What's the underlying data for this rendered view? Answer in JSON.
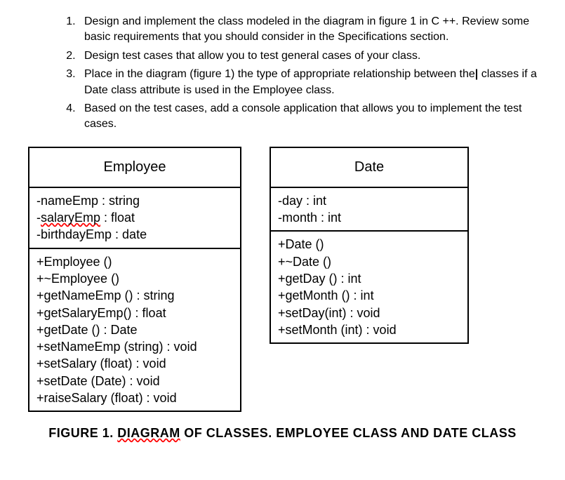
{
  "instructions": {
    "item1": "Design and implement the class modeled in the diagram in figure 1 in C ++. Review some basic requirements that you should consider in the Specifications section.",
    "item2": "Design test cases that allow you to test general cases of your class.",
    "item3_part1": "Place in the diagram (figure 1) the type of appropriate relationship between the",
    "item3_cursor": "|",
    "item3_part2": " classes if a Date class attribute is used in the Employee class.",
    "item4": "Based on the test cases, add a console application that allows you to implement the test cases."
  },
  "uml": {
    "employee": {
      "title": "Employee",
      "attr1": "-nameEmp : string",
      "attr2_prefix": "-",
      "attr2_wavy": "salaryEmp",
      "attr2_suffix": " : float",
      "attr3": "-birthdayEmp : date",
      "ops": {
        "o1": "+Employee ()",
        "o2": "+~Employee ()",
        "o3": "+getNameEmp () : string",
        "o4": "+getSalaryEmp() : float",
        "o5": "+getDate () : Date",
        "o6": "+setNameEmp (string) : void",
        "o7": "+setSalary (float) : void",
        "o8": "+setDate (Date) : void",
        "o9": "+raiseSalary (float) : void"
      }
    },
    "date": {
      "title": "Date",
      "attr1": "-day : int",
      "attr2": "-month : int",
      "ops": {
        "o1": "+Date ()",
        "o2": "+~Date ()",
        "o3": "+getDay () : int",
        "o4": "+getMonth () : int",
        "o5": "+setDay(int) : void",
        "o6": "+setMonth (int) : void"
      }
    }
  },
  "caption": {
    "prefix": "FIGURE 1. ",
    "wavy": "DIAGRAM",
    "suffix": " OF CLASSES. EMPLOYEE CLASS AND DATE CLASS"
  }
}
